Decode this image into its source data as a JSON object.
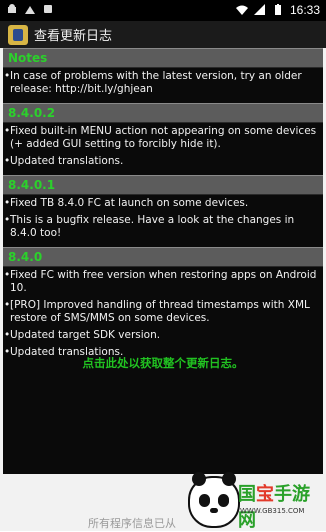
{
  "status_bar": {
    "time": "16:33",
    "left_icons": [
      "android-icon",
      "image-icon",
      "notification-icon"
    ],
    "right_icons": [
      "wifi-icon",
      "signal-icon",
      "battery-icon"
    ]
  },
  "app": {
    "title": "查看更新日志",
    "icon": "app-icon"
  },
  "sections": [
    {
      "header": "Notes",
      "items": [
        "In case of problems with the latest version, try an older release: http://bit.ly/ghjean"
      ]
    },
    {
      "header": "8.4.0.2",
      "items": [
        "Fixed built-in MENU action not appearing on some devices (+ added GUI setting to forcibly hide it).",
        "Updated translations."
      ]
    },
    {
      "header": "8.4.0.1",
      "items": [
        "Fixed TB 8.4.0 FC at launch on some devices.",
        "This is a bugfix release. Have a look at the changes in 8.4.0 too!"
      ]
    },
    {
      "header": "8.4.0",
      "items": [
        "Fixed FC with free version when restoring apps on Android 10.",
        "[PRO] Improved handling of thread timestamps with XML restore of SMS/MMS on some devices.",
        "Updated target SDK version.",
        "Updated translations."
      ]
    }
  ],
  "footer_link": "点击此处以获取整个更新日志。",
  "bottom_text": "所有程序信息已从",
  "watermark": {
    "title_part1": "国",
    "title_part2": "宝",
    "title_part3": "手游网",
    "url": "WWW.GB315.COM"
  },
  "colors": {
    "section_header_text": "#2bd12b",
    "footer_link": "#21c221",
    "content_bg": "#0a0a0a"
  }
}
